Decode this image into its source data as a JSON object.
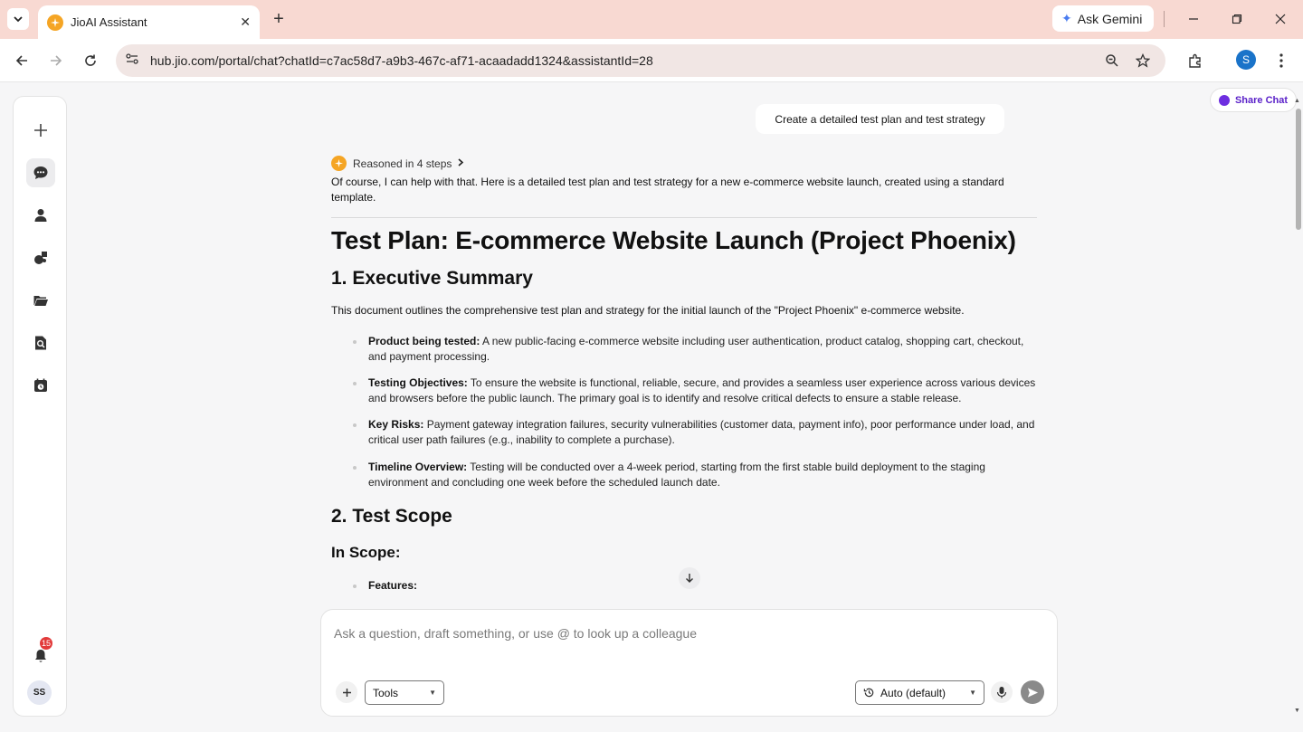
{
  "browser": {
    "tab_title": "JioAI Assistant",
    "url": "hub.jio.com/portal/chat?chatId=c7ac58d7-a9b3-467c-af71-acaadadd1324&assistantId=28",
    "gemini_label": "Ask Gemini",
    "profile_initial": "S"
  },
  "sidebar": {
    "notification_count": "15",
    "user_initials": "SS"
  },
  "header": {
    "share_label": "Share Chat"
  },
  "chat": {
    "user_message": "Create a detailed test plan and test strategy",
    "reasoned_label": "Reasoned in 4 steps",
    "intro": "Of course, I can help with that. Here is a detailed test plan and test strategy for a new e-commerce website launch, created using a standard template.",
    "doc_title": "Test Plan: E-commerce Website Launch (Project Phoenix)",
    "section1_title": "1. Executive Summary",
    "section1_para": "This document outlines the comprehensive test plan and strategy for the initial launch of the \"Project Phoenix\" e-commerce website.",
    "bullets": [
      {
        "label": "Product being tested:",
        "text": " A new public-facing e-commerce website including user authentication, product catalog, shopping cart, checkout, and payment processing."
      },
      {
        "label": "Testing Objectives:",
        "text": " To ensure the website is functional, reliable, secure, and provides a seamless user experience across various devices and browsers before the public launch. The primary goal is to identify and resolve critical defects to ensure a stable release."
      },
      {
        "label": "Key Risks:",
        "text": " Payment gateway integration failures, security vulnerabilities (customer data, payment info), poor performance under load, and critical user path failures (e.g., inability to complete a purchase)."
      },
      {
        "label": "Timeline Overview:",
        "text": " Testing will be conducted over a 4-week period, starting from the first stable build deployment to the staging environment and concluding one week before the scheduled launch date."
      }
    ],
    "section2_title": "2. Test Scope",
    "in_scope_title": "In Scope:",
    "features_label": "Features:"
  },
  "composer": {
    "placeholder": "Ask a question, draft something, or use @ to look up a colleague",
    "tools_label": "Tools",
    "model_label": "Auto (default)"
  },
  "colors": {
    "chrome_bg": "#f8d9d2",
    "accent_orange": "#f5a524",
    "share_purple": "#5b22c9"
  }
}
